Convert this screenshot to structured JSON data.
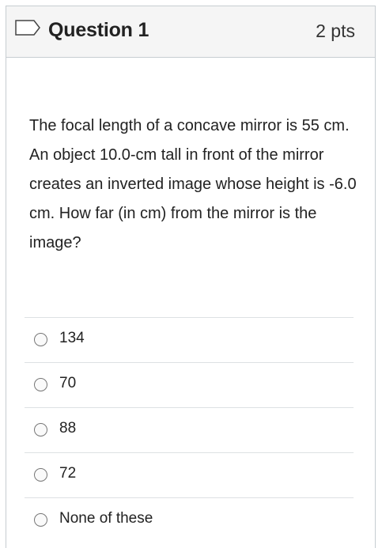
{
  "question": {
    "title": "Question 1",
    "points": "2 pts",
    "text": "The focal length of a concave mirror is 55 cm.  An object 10.0-cm tall in front of the mirror creates an inverted image whose height is -6.0 cm. How far (in cm) from the mirror is the image?"
  },
  "answers": [
    {
      "label": "134"
    },
    {
      "label": "70"
    },
    {
      "label": "88"
    },
    {
      "label": "72"
    },
    {
      "label": "None of these"
    }
  ],
  "icons": {
    "flag": "flag-icon",
    "radio": "radio-button"
  }
}
